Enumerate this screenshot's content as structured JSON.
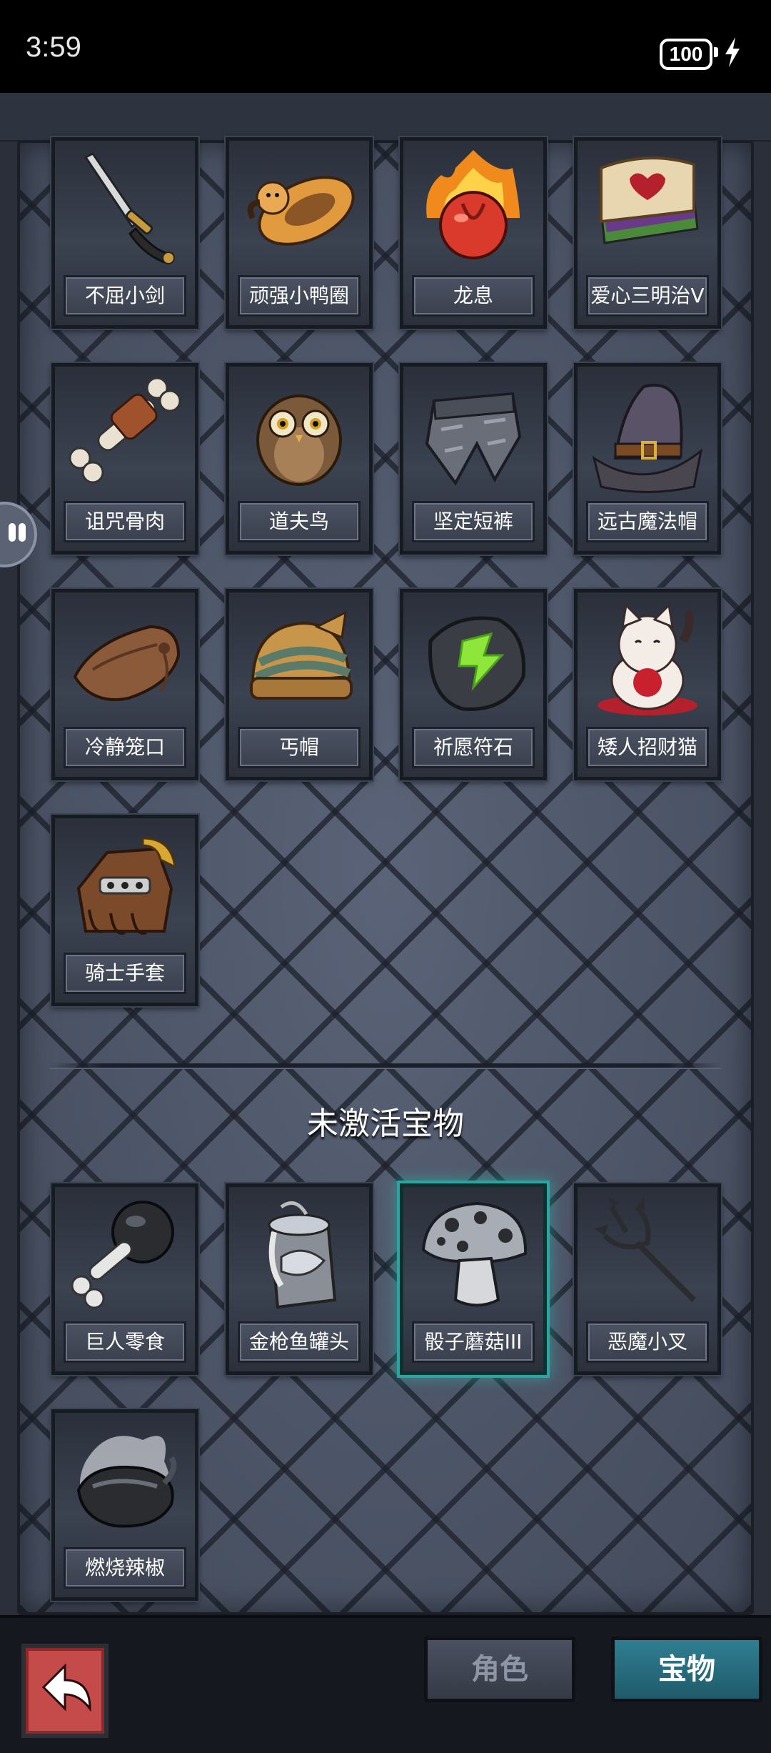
{
  "status_bar": {
    "time": "3:59",
    "battery": "100"
  },
  "active_items": [
    {
      "name": "不屈小剑",
      "icon": "sword-icon"
    },
    {
      "name": "顽强小鸭圈",
      "icon": "duck-ring-icon"
    },
    {
      "name": "龙息",
      "icon": "flaming-heart-icon"
    },
    {
      "name": "爱心三明治V",
      "icon": "heart-sandwich-icon"
    },
    {
      "name": "诅咒骨肉",
      "icon": "bone-meat-icon"
    },
    {
      "name": "道夫鸟",
      "icon": "owl-icon"
    },
    {
      "name": "坚定短裤",
      "icon": "armor-shorts-icon"
    },
    {
      "name": "远古魔法帽",
      "icon": "wizard-hat-icon"
    },
    {
      "name": "冷静笼口",
      "icon": "muzzle-icon"
    },
    {
      "name": "丐帽",
      "icon": "beanie-icon"
    },
    {
      "name": "祈愿符石",
      "icon": "rune-stone-icon"
    },
    {
      "name": "矮人招财猫",
      "icon": "lucky-cat-icon"
    },
    {
      "name": "骑士手套",
      "icon": "gauntlet-icon"
    }
  ],
  "inactive_section_title": "未激活宝物",
  "inactive_items": [
    {
      "name": "巨人零食",
      "icon": "bone-club-icon"
    },
    {
      "name": "金枪鱼罐头",
      "icon": "tuna-can-icon"
    },
    {
      "name": "骰子蘑菇III",
      "icon": "dice-mushroom-icon",
      "selected": true
    },
    {
      "name": "恶魔小叉",
      "icon": "trident-icon"
    },
    {
      "name": "燃烧辣椒",
      "icon": "burning-pepper-icon"
    }
  ],
  "bottom_nav": {
    "tab_role": "角色",
    "tab_treasure": "宝物",
    "active_tab": "宝物"
  },
  "colors": {
    "accent_teal": "#2aa6a0",
    "back_button": "#c54a4a",
    "panel": "#4a5264"
  }
}
